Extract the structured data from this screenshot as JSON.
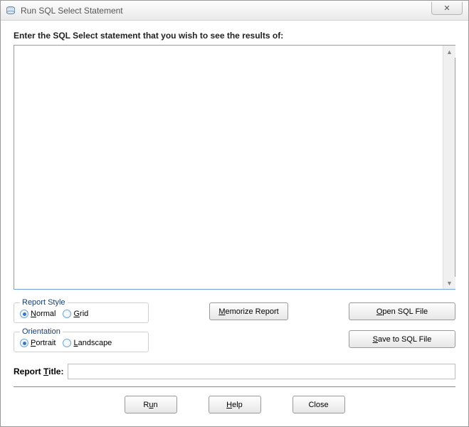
{
  "window": {
    "title": "Run SQL Select Statement",
    "close_glyph": "✕"
  },
  "prompt": "Enter the SQL Select statement that you wish to see the results of:",
  "sql_text": "",
  "report_style": {
    "legend": "Report Style",
    "options": [
      {
        "label_pre": "",
        "mn": "N",
        "label_post": "ormal",
        "selected": true
      },
      {
        "label_pre": "",
        "mn": "G",
        "label_post": "rid",
        "selected": false
      }
    ]
  },
  "orientation": {
    "legend": "Orientation",
    "options": [
      {
        "label_pre": "",
        "mn": "P",
        "label_post": "ortrait",
        "selected": true
      },
      {
        "label_pre": "",
        "mn": "L",
        "label_post": "andscape",
        "selected": false
      }
    ]
  },
  "buttons": {
    "memorize_pre": "",
    "memorize_mn": "M",
    "memorize_post": "emorize Report",
    "open_pre": "",
    "open_mn": "O",
    "open_post": "pen SQL File",
    "save_pre": "",
    "save_mn": "S",
    "save_post": "ave to SQL File",
    "run_pre": "R",
    "run_mn": "u",
    "run_post": "n",
    "help_pre": "",
    "help_mn": "H",
    "help_post": "elp",
    "close_label": "Close"
  },
  "report_title": {
    "label_pre": "Report ",
    "label_mn": "T",
    "label_post": "itle:",
    "value": ""
  }
}
